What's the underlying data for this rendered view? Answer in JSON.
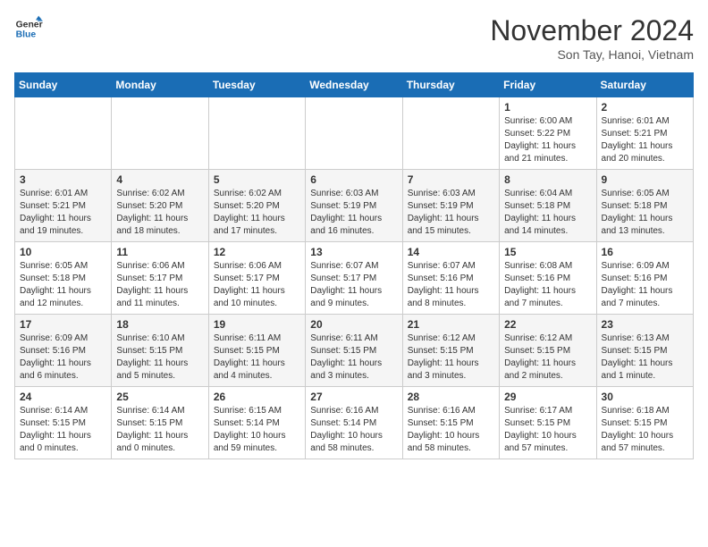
{
  "header": {
    "logo_line1": "General",
    "logo_line2": "Blue",
    "month": "November 2024",
    "location": "Son Tay, Hanoi, Vietnam"
  },
  "days_of_week": [
    "Sunday",
    "Monday",
    "Tuesday",
    "Wednesday",
    "Thursday",
    "Friday",
    "Saturday"
  ],
  "weeks": [
    [
      {
        "day": "",
        "info": ""
      },
      {
        "day": "",
        "info": ""
      },
      {
        "day": "",
        "info": ""
      },
      {
        "day": "",
        "info": ""
      },
      {
        "day": "",
        "info": ""
      },
      {
        "day": "1",
        "info": "Sunrise: 6:00 AM\nSunset: 5:22 PM\nDaylight: 11 hours\nand 21 minutes."
      },
      {
        "day": "2",
        "info": "Sunrise: 6:01 AM\nSunset: 5:21 PM\nDaylight: 11 hours\nand 20 minutes."
      }
    ],
    [
      {
        "day": "3",
        "info": "Sunrise: 6:01 AM\nSunset: 5:21 PM\nDaylight: 11 hours\nand 19 minutes."
      },
      {
        "day": "4",
        "info": "Sunrise: 6:02 AM\nSunset: 5:20 PM\nDaylight: 11 hours\nand 18 minutes."
      },
      {
        "day": "5",
        "info": "Sunrise: 6:02 AM\nSunset: 5:20 PM\nDaylight: 11 hours\nand 17 minutes."
      },
      {
        "day": "6",
        "info": "Sunrise: 6:03 AM\nSunset: 5:19 PM\nDaylight: 11 hours\nand 16 minutes."
      },
      {
        "day": "7",
        "info": "Sunrise: 6:03 AM\nSunset: 5:19 PM\nDaylight: 11 hours\nand 15 minutes."
      },
      {
        "day": "8",
        "info": "Sunrise: 6:04 AM\nSunset: 5:18 PM\nDaylight: 11 hours\nand 14 minutes."
      },
      {
        "day": "9",
        "info": "Sunrise: 6:05 AM\nSunset: 5:18 PM\nDaylight: 11 hours\nand 13 minutes."
      }
    ],
    [
      {
        "day": "10",
        "info": "Sunrise: 6:05 AM\nSunset: 5:18 PM\nDaylight: 11 hours\nand 12 minutes."
      },
      {
        "day": "11",
        "info": "Sunrise: 6:06 AM\nSunset: 5:17 PM\nDaylight: 11 hours\nand 11 minutes."
      },
      {
        "day": "12",
        "info": "Sunrise: 6:06 AM\nSunset: 5:17 PM\nDaylight: 11 hours\nand 10 minutes."
      },
      {
        "day": "13",
        "info": "Sunrise: 6:07 AM\nSunset: 5:17 PM\nDaylight: 11 hours\nand 9 minutes."
      },
      {
        "day": "14",
        "info": "Sunrise: 6:07 AM\nSunset: 5:16 PM\nDaylight: 11 hours\nand 8 minutes."
      },
      {
        "day": "15",
        "info": "Sunrise: 6:08 AM\nSunset: 5:16 PM\nDaylight: 11 hours\nand 7 minutes."
      },
      {
        "day": "16",
        "info": "Sunrise: 6:09 AM\nSunset: 5:16 PM\nDaylight: 11 hours\nand 7 minutes."
      }
    ],
    [
      {
        "day": "17",
        "info": "Sunrise: 6:09 AM\nSunset: 5:16 PM\nDaylight: 11 hours\nand 6 minutes."
      },
      {
        "day": "18",
        "info": "Sunrise: 6:10 AM\nSunset: 5:15 PM\nDaylight: 11 hours\nand 5 minutes."
      },
      {
        "day": "19",
        "info": "Sunrise: 6:11 AM\nSunset: 5:15 PM\nDaylight: 11 hours\nand 4 minutes."
      },
      {
        "day": "20",
        "info": "Sunrise: 6:11 AM\nSunset: 5:15 PM\nDaylight: 11 hours\nand 3 minutes."
      },
      {
        "day": "21",
        "info": "Sunrise: 6:12 AM\nSunset: 5:15 PM\nDaylight: 11 hours\nand 3 minutes."
      },
      {
        "day": "22",
        "info": "Sunrise: 6:12 AM\nSunset: 5:15 PM\nDaylight: 11 hours\nand 2 minutes."
      },
      {
        "day": "23",
        "info": "Sunrise: 6:13 AM\nSunset: 5:15 PM\nDaylight: 11 hours\nand 1 minute."
      }
    ],
    [
      {
        "day": "24",
        "info": "Sunrise: 6:14 AM\nSunset: 5:15 PM\nDaylight: 11 hours\nand 0 minutes."
      },
      {
        "day": "25",
        "info": "Sunrise: 6:14 AM\nSunset: 5:15 PM\nDaylight: 11 hours\nand 0 minutes."
      },
      {
        "day": "26",
        "info": "Sunrise: 6:15 AM\nSunset: 5:14 PM\nDaylight: 10 hours\nand 59 minutes."
      },
      {
        "day": "27",
        "info": "Sunrise: 6:16 AM\nSunset: 5:14 PM\nDaylight: 10 hours\nand 58 minutes."
      },
      {
        "day": "28",
        "info": "Sunrise: 6:16 AM\nSunset: 5:15 PM\nDaylight: 10 hours\nand 58 minutes."
      },
      {
        "day": "29",
        "info": "Sunrise: 6:17 AM\nSunset: 5:15 PM\nDaylight: 10 hours\nand 57 minutes."
      },
      {
        "day": "30",
        "info": "Sunrise: 6:18 AM\nSunset: 5:15 PM\nDaylight: 10 hours\nand 57 minutes."
      }
    ]
  ]
}
